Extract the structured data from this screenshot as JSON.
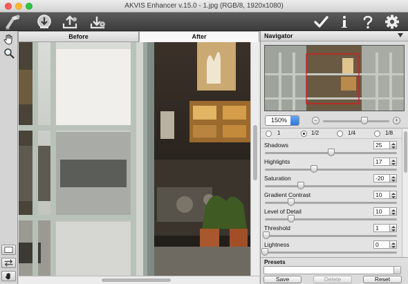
{
  "window": {
    "title": "AKVIS Enhancer v.15.0 - 1.jpg (RGB/8, 1920x1080)"
  },
  "toolbar": {
    "icons": [
      "app-logo-icon",
      "open-image-icon",
      "save-image-icon",
      "batch-process-icon",
      "apply-check-icon",
      "info-icon",
      "help-icon",
      "settings-gear-icon"
    ]
  },
  "tools": {
    "icons": [
      "hand-icon",
      "zoom-icon",
      "single-view-icon",
      "swap-view-icon",
      "hand-bottom-icon"
    ]
  },
  "tabs": {
    "before": "Before",
    "after": "After"
  },
  "navigator": {
    "title": "Navigator",
    "zoom": "150%",
    "zoom_minus": "−",
    "zoom_plus": "+",
    "zoom_level": 0.62
  },
  "scale": {
    "options": [
      "1",
      "1/2",
      "1/4",
      "1/8"
    ],
    "selected": "1/2"
  },
  "params": [
    {
      "label": "Shadows",
      "value": "25",
      "level": 0.5
    },
    {
      "label": "Highlights",
      "value": "17",
      "level": 0.37
    },
    {
      "label": "Saturation",
      "value": "-20",
      "level": 0.27
    },
    {
      "label": "Gradient Contrast",
      "value": "10",
      "level": 0.2
    },
    {
      "label": "Level of Detail",
      "value": "10",
      "level": 0.2
    },
    {
      "label": "Threshold",
      "value": "1",
      "level": 0.01
    },
    {
      "label": "Lightness",
      "value": "0",
      "level": 0.0
    }
  ],
  "presets": {
    "title": "Presets",
    "selected": "",
    "save_label": "Save",
    "delete_label": "Delete",
    "reset_label": "Reset"
  },
  "colors": {
    "toolbar": "#4a4a4a",
    "panel": "#dcdcdc",
    "accent_blue": "#2e74d9"
  }
}
